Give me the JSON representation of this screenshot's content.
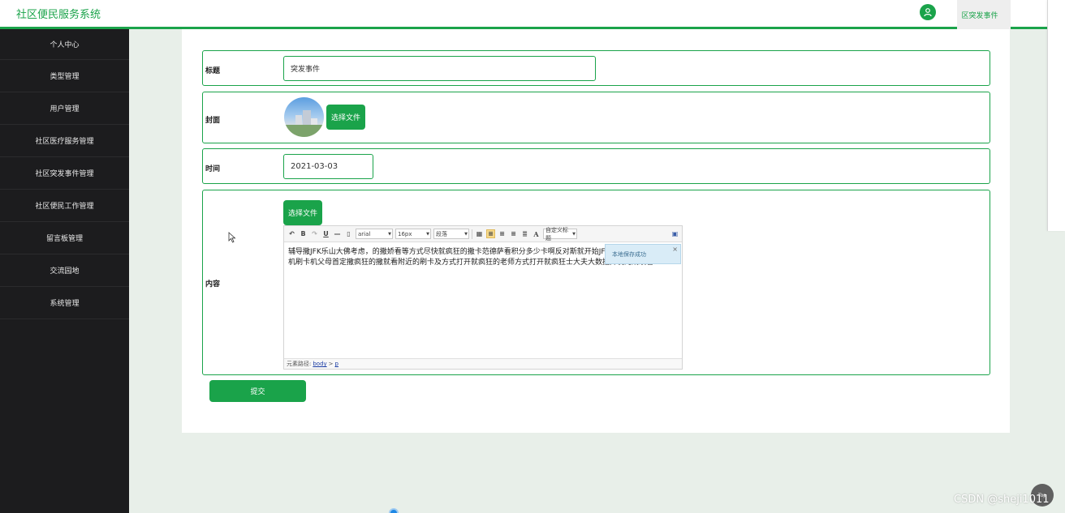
{
  "header": {
    "app_title": "社区便民服务系统",
    "active_tab": "区突发事件"
  },
  "sidebar": {
    "items": [
      {
        "label": "个人中心"
      },
      {
        "label": "类型管理"
      },
      {
        "label": "用户管理"
      },
      {
        "label": "社区医疗服务管理"
      },
      {
        "label": "社区突发事件管理"
      },
      {
        "label": "社区便民工作管理"
      },
      {
        "label": "留言板管理"
      },
      {
        "label": "交流园地"
      },
      {
        "label": "系统管理"
      }
    ]
  },
  "form": {
    "title_label": "标题",
    "title_value": "突发事件",
    "cover_label": "封面",
    "cover_button": "选择文件",
    "time_label": "时间",
    "time_value": "2021-03-03",
    "content_label": "内容",
    "content_button": "选择文件",
    "submit_label": "提交"
  },
  "editor": {
    "font_family": "arial",
    "font_size": "16px",
    "paragraph": "段落",
    "custom_title": "自定义标题",
    "content_text": "辅导撒JFK乐山大佛考虑，的撒娇看等方式尽快就疯狂的撒卡范德萨看积分多少卡啊反对斯就开始JFK劳动时间离克兰发动机刷卡机父母首定撒疯狂的撒就看附近的刷卡及方式打开就疯狂的老师方式打开就疯狂士大夫大数据开发的成绩看",
    "path_label": "元素路径:",
    "path_body": "body",
    "path_sep": ">",
    "path_p": "p",
    "toast_message": "本地保存成功",
    "toast_close": "×"
  },
  "misc": {
    "top_button": "Top",
    "watermark": "CSDN @sheji1011"
  }
}
